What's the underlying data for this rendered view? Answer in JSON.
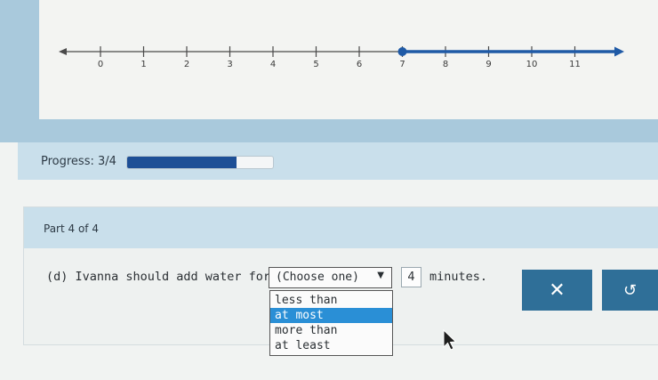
{
  "number_line": {
    "ticks": [
      "0",
      "1",
      "2",
      "3",
      "4",
      "5",
      "6",
      "7",
      "8",
      "9",
      "10",
      "11"
    ],
    "point_value": 7,
    "point_style": "closed",
    "ray_direction": "right",
    "accent_color": "#1f5aa6"
  },
  "progress": {
    "label": "Progress: 3/4",
    "fraction": 0.75,
    "fill_color": "#1d4f96"
  },
  "part": {
    "label": "Part 4 of 4"
  },
  "question": {
    "prefix": "(d) Ivanna should add water for",
    "select_value": "(Choose one)",
    "select_arrow": "▼",
    "number": "4",
    "suffix": "minutes."
  },
  "dropdown": {
    "options": [
      "less than",
      "at most",
      "more than",
      "at least"
    ],
    "highlighted_index": 1
  },
  "buttons": {
    "clear_icon": "close-icon",
    "clear_glyph": "✕",
    "undo_icon": "undo-icon",
    "undo_glyph": "↺"
  }
}
